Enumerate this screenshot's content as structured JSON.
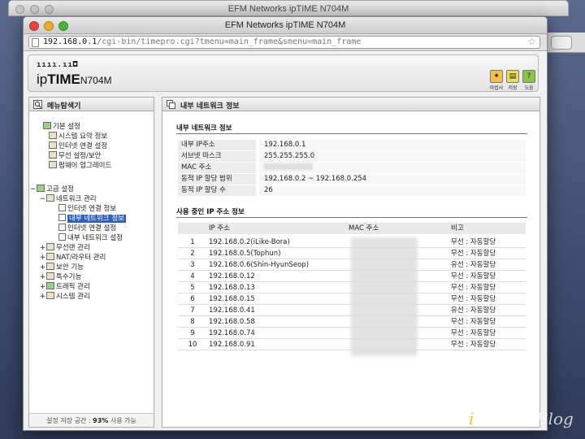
{
  "background_window": {
    "title": "EFM Networks ipTIME N704M"
  },
  "window": {
    "title": "EFM Networks ipTIME N704M",
    "url_host": "192.168.0.1",
    "url_path": "/cgi-bin/timepro.cgi?tmenu=main_frame&smenu=main_frame"
  },
  "header": {
    "logo_dots": "ıııı.ıı◘",
    "brand_ip": "ip",
    "brand_time": "TIME",
    "model": "N704M",
    "buttons": [
      {
        "label": "마법사",
        "icon": "wizard-icon",
        "color": "#f5c04a"
      },
      {
        "label": "저장",
        "icon": "save-icon",
        "color": "#e8dc5a"
      },
      {
        "label": "도움",
        "icon": "help-icon",
        "color": "#8bc34a"
      }
    ],
    "help_glyph": "?"
  },
  "left_panel": {
    "title": "메뉴탐색기",
    "tree": [
      {
        "label": "기본 설정",
        "level": 0,
        "toggle": ""
      },
      {
        "label": "시스템 요약 정보",
        "level": 1,
        "toggle": ""
      },
      {
        "label": "인터넷 연결 설정",
        "level": 1,
        "toggle": ""
      },
      {
        "label": "무선 설정/보안",
        "level": 1,
        "toggle": ""
      },
      {
        "label": "펌웨어 업그레이드",
        "level": 1,
        "toggle": ""
      },
      {
        "label": "고급 설정",
        "level": 0,
        "toggle": "−"
      },
      {
        "label": "네트워크 관리",
        "level": 1,
        "toggle": "−"
      },
      {
        "label": "인터넷 연결 정보",
        "level": 2,
        "toggle": ""
      },
      {
        "label": "내부 네트워크 정보",
        "level": 2,
        "toggle": "",
        "selected": true
      },
      {
        "label": "인터넷 연결 설정",
        "level": 2,
        "toggle": ""
      },
      {
        "label": "내부 네트워크 설정",
        "level": 2,
        "toggle": ""
      },
      {
        "label": "무선랜 관리",
        "level": 1,
        "toggle": "+"
      },
      {
        "label": "NAT/라우터 관리",
        "level": 1,
        "toggle": "+"
      },
      {
        "label": "보안 기능",
        "level": 1,
        "toggle": "+"
      },
      {
        "label": "특수기능",
        "level": 1,
        "toggle": "+"
      },
      {
        "label": "트래픽 관리",
        "level": 1,
        "toggle": "+"
      },
      {
        "label": "시스템 관리",
        "level": 1,
        "toggle": "+"
      }
    ],
    "footer_prefix": "설정 저장 공간 : ",
    "footer_value": "93%",
    "footer_suffix": " 사용 가능"
  },
  "right_panel": {
    "title": "내부 네트워크 정보",
    "section1_title": "내부 네트워크 정보",
    "info": [
      {
        "key": "내부 IP주소",
        "value": "192.168.0.1"
      },
      {
        "key": "서브넷 마스크",
        "value": "255.255.255.0"
      },
      {
        "key": "MAC 주소",
        "value": ""
      },
      {
        "key": "동적 IP 할당 범위",
        "value": "192.168.0.2 ~  192.168.0.254"
      },
      {
        "key": "동적 IP 할당 수",
        "value": "26"
      }
    ],
    "section2_title": "사용 중인 IP 주소 정보",
    "table_headers": {
      "ip": "IP 주소",
      "mac": "MAC 주소",
      "note": "비고"
    },
    "rows": [
      {
        "no": "1",
        "ip": "192.168.0.2(iLike-Bora)",
        "note": "무선 : 자동할당"
      },
      {
        "no": "2",
        "ip": "192.168.0.5(Tophun)",
        "note": "무선 : 자동할당"
      },
      {
        "no": "3",
        "ip": "192.168.0.6(Shin-HyunSeop)",
        "note": "유선 : 자동할당"
      },
      {
        "no": "4",
        "ip": "192.168.0.12",
        "note": "무선 : 자동할당"
      },
      {
        "no": "5",
        "ip": "192.168.0.13",
        "note": "무선 : 자동할당"
      },
      {
        "no": "6",
        "ip": "192.168.0.15",
        "note": "무선 : 자동할당"
      },
      {
        "no": "7",
        "ip": "192.168.0.41",
        "note": "유선 : 자동할당"
      },
      {
        "no": "8",
        "ip": "192.168.0.58",
        "note": "무선 : 자동할당"
      },
      {
        "no": "9",
        "ip": "192.168.0.74",
        "note": "무선 : 자동할당"
      },
      {
        "no": "10",
        "ip": "192.168.0.91",
        "note": "무선 : 자동할당"
      }
    ]
  },
  "watermark": {
    "text_i": "i",
    "text_rest": "MON's Blog"
  }
}
